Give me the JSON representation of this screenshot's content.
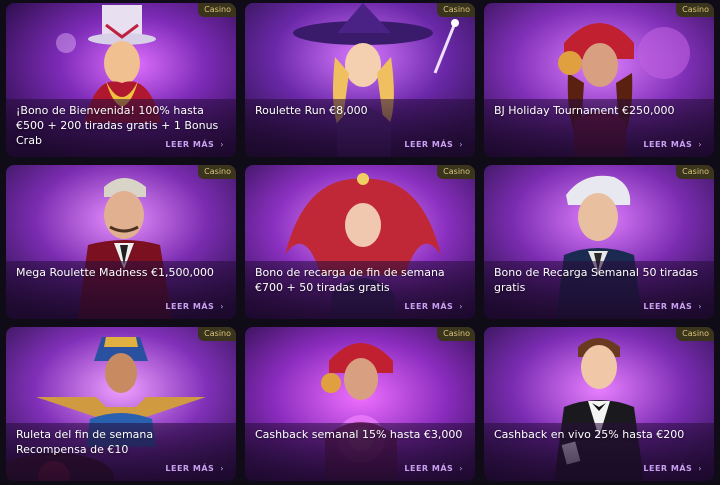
{
  "promotions": [
    {
      "badge": "Casino",
      "title": "¡Bono de Bienvenida! 100% hasta €500 + 200 tiradas gratis + 1 Bonus Crab",
      "link_label": "LEER MÁS",
      "art": "magician"
    },
    {
      "badge": "Casino",
      "title": "Roulette Run €8,000",
      "link_label": "LEER MÁS",
      "art": "witch"
    },
    {
      "badge": "Casino",
      "title": "BJ Holiday Tournament €250,000",
      "link_label": "LEER MÁS",
      "art": "fortune-teller"
    },
    {
      "badge": "Casino",
      "title": "Mega Roulette Madness €1,500,000",
      "link_label": "LEER MÁS",
      "art": "gentleman"
    },
    {
      "badge": "Casino",
      "title": "Bono de recarga de fin de semana €700 + 50 tiradas gratis",
      "link_label": "LEER MÁS",
      "art": "red-hair-woman"
    },
    {
      "badge": "Casino",
      "title": "Bono de Recarga Semanal 50 tiradas gratis",
      "link_label": "LEER MÁS",
      "art": "boy"
    },
    {
      "badge": "Casino",
      "title": "Ruleta del fin de semana Recompensa de €10",
      "link_label": "LEER MÁS",
      "art": "pharaoh"
    },
    {
      "badge": "Casino",
      "title": "Cashback semanal 15% hasta €3,000",
      "link_label": "LEER MÁS",
      "art": "fortune-teller"
    },
    {
      "badge": "Casino",
      "title": "Cashback en vivo 25% hasta €200",
      "link_label": "LEER MÁS",
      "art": "dealer"
    }
  ],
  "colors": {
    "badge_bg": "#3a341d",
    "badge_text": "#d9c57a",
    "link": "#c9a0f0",
    "card_glow": "#b040e0"
  }
}
